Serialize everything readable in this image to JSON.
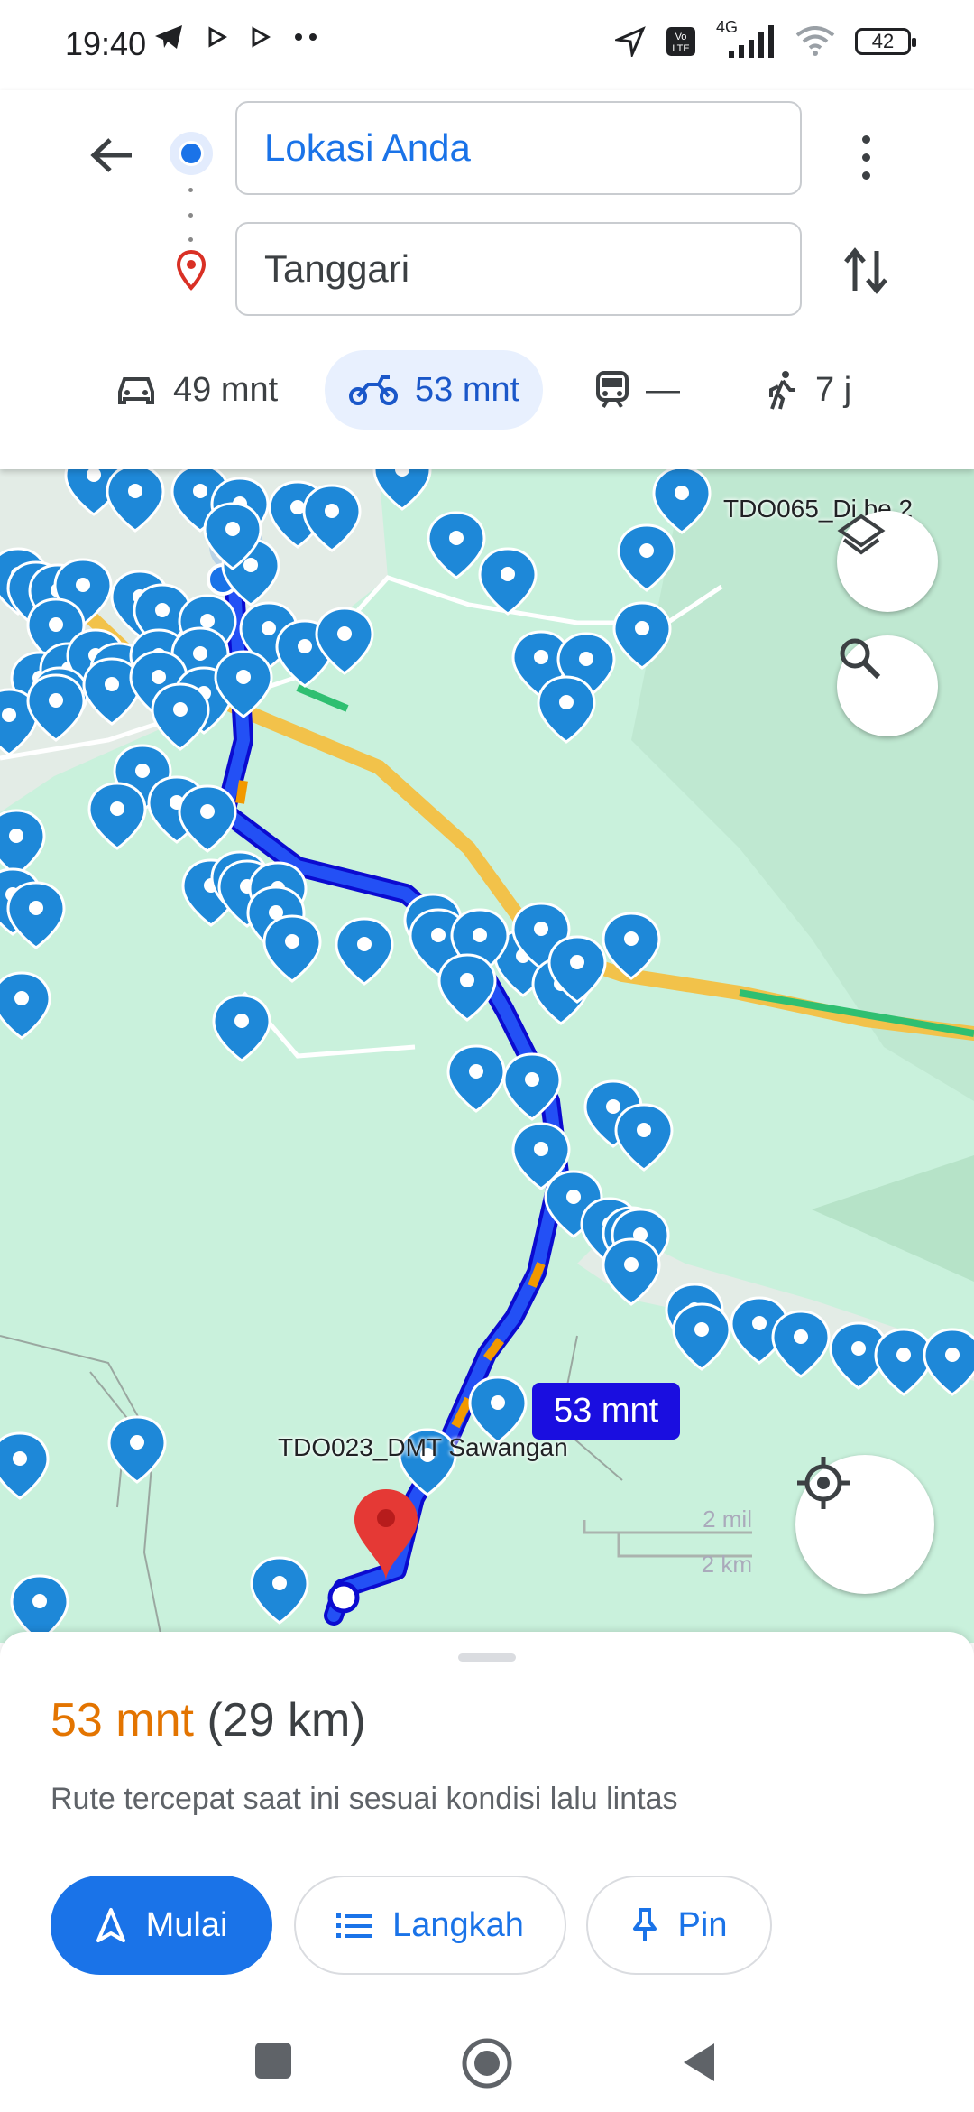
{
  "status_bar": {
    "time": "19:40",
    "network": "4G",
    "battery": "42"
  },
  "directions": {
    "origin": "Lokasi Anda",
    "destination": "Tanggari",
    "modes": [
      {
        "name": "car",
        "label": "49 mnt"
      },
      {
        "name": "motorcycle",
        "label": "53 mnt",
        "active": true
      },
      {
        "name": "transit",
        "label": "—"
      },
      {
        "name": "walk",
        "label": "7 j"
      }
    ]
  },
  "map": {
    "labels": {
      "top_right": "TDO065_Di     be 2",
      "bottom": "TDO023_DMT Sawangan"
    },
    "eta_chip": "53 mnt",
    "scale_mi": "2 mil",
    "scale_km": "2 km"
  },
  "route": {
    "duration": "53 mnt",
    "distance": "(29 km)",
    "description": "Rute tercepat saat ini sesuai kondisi lalu lintas",
    "buttons": {
      "start": "Mulai",
      "steps": "Langkah",
      "pin": "Pin"
    }
  },
  "colors": {
    "accent": "#1a73e8",
    "duration": "#e37400",
    "route": "#1a0ee0",
    "map_bg": "#c9f1dc"
  }
}
